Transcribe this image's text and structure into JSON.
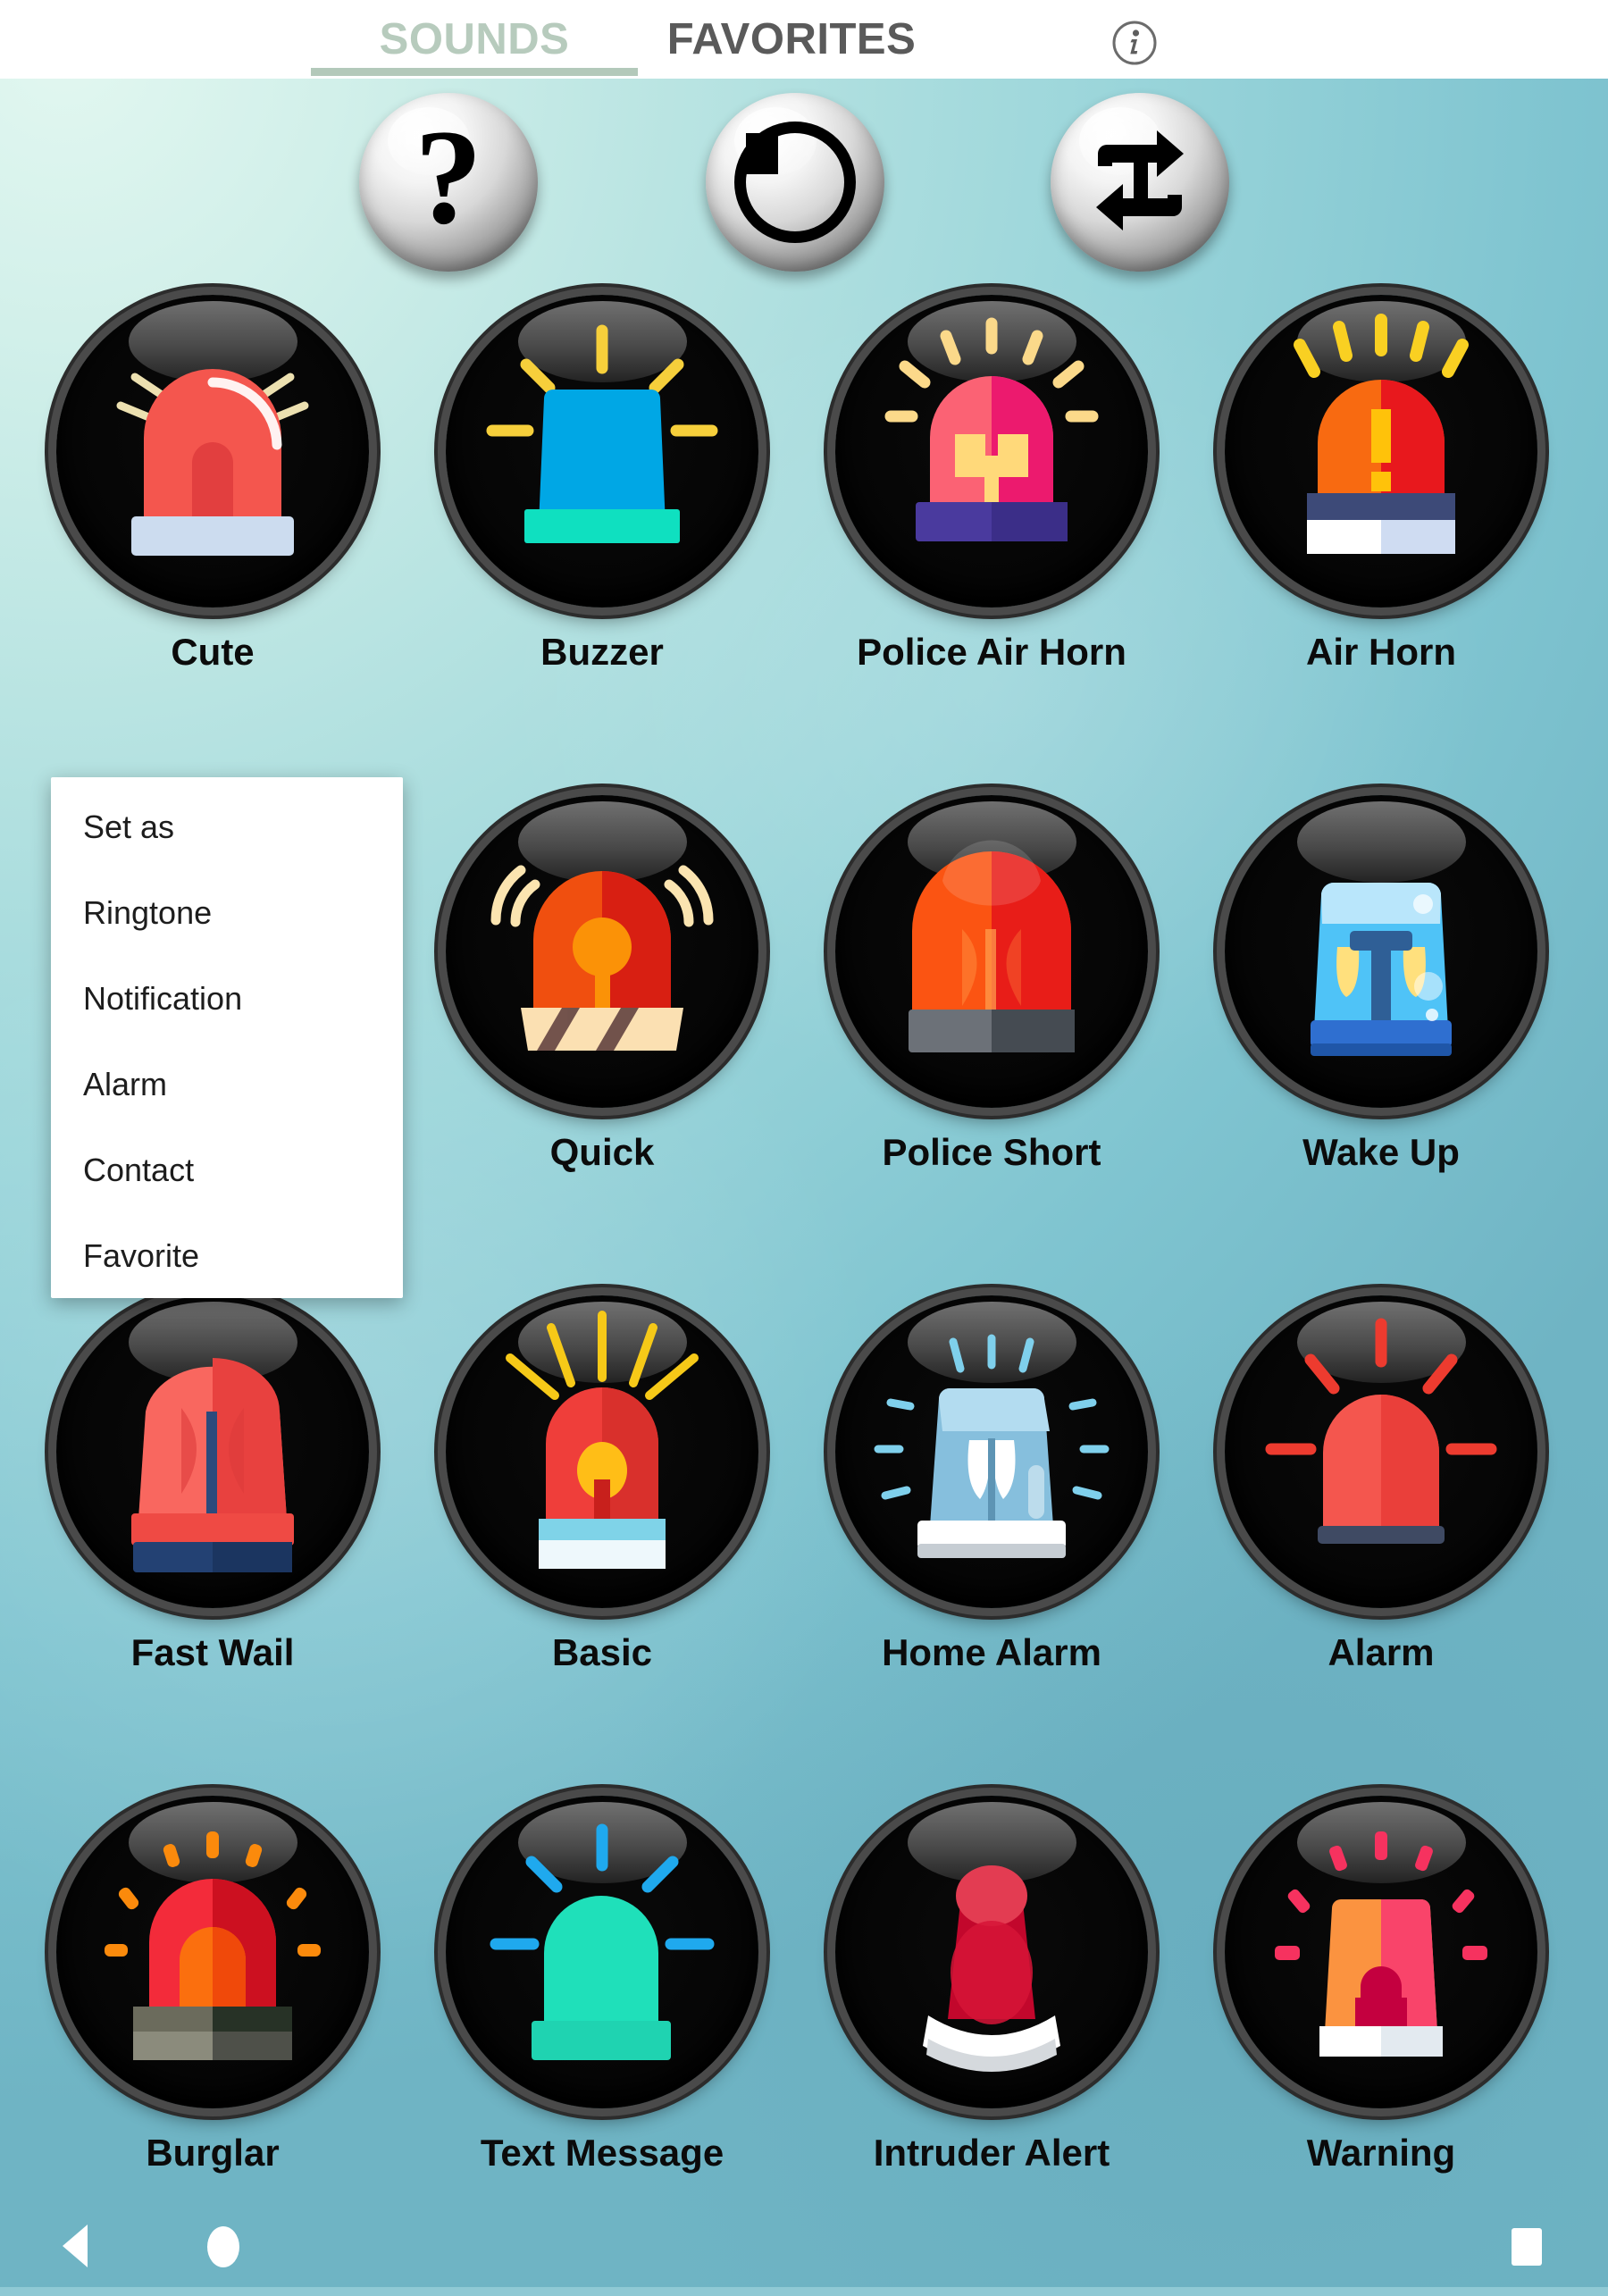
{
  "app": {
    "background_top_color": "#d9f3ec",
    "background_bottom_color": "#6fb4c4"
  },
  "tabs": {
    "items": [
      {
        "label": "SOUNDS",
        "active": true,
        "color": "#b7cbbd"
      },
      {
        "label": "FAVORITES",
        "active": false,
        "color": "#5a5a5a"
      }
    ],
    "info_icon": "info-icon"
  },
  "controls": [
    {
      "name": "help-button",
      "icon": "question-mark-icon",
      "glyph": "?"
    },
    {
      "name": "stop-button",
      "icon": "stop-icon",
      "glyph": ""
    },
    {
      "name": "loop-button",
      "icon": "repeat-icon",
      "glyph": ""
    }
  ],
  "context_menu": {
    "items": [
      {
        "label": "Set as"
      },
      {
        "label": "Ringtone"
      },
      {
        "label": "Notification"
      },
      {
        "label": "Alarm"
      },
      {
        "label": "Contact"
      },
      {
        "label": "Favorite"
      }
    ]
  },
  "sounds": {
    "rows": [
      [
        {
          "label": "Cute",
          "icon": "siren-red-dome-icon"
        },
        {
          "label": "Buzzer",
          "icon": "siren-blue-square-icon"
        },
        {
          "label": "Police Air Horn",
          "icon": "siren-pink-horn-icon"
        },
        {
          "label": "Air Horn",
          "icon": "siren-orange-exclaim-icon"
        }
      ],
      [
        {
          "label": "",
          "icon": ""
        },
        {
          "label": "Quick",
          "icon": "siren-red-pin-icon"
        },
        {
          "label": "Police Short",
          "icon": "siren-orange-red-icon"
        },
        {
          "label": "Wake Up",
          "icon": "siren-blue-bell-icon"
        }
      ],
      [
        {
          "label": "Fast Wail",
          "icon": "siren-red-navy-icon"
        },
        {
          "label": "Basic",
          "icon": "siren-red-rays-icon"
        },
        {
          "label": "Home Alarm",
          "icon": "siren-lightblue-bell-icon"
        },
        {
          "label": "Alarm",
          "icon": "siren-red-flash-icon"
        }
      ],
      [
        {
          "label": "Burglar",
          "icon": "siren-red-orange-icon"
        },
        {
          "label": "Text Message",
          "icon": "siren-teal-icon"
        },
        {
          "label": "Intruder Alert",
          "icon": "siren-crimson-bulb-icon"
        },
        {
          "label": "Warning",
          "icon": "siren-orange-lock-icon"
        }
      ]
    ]
  },
  "navbar": {
    "back": "back-triangle-icon",
    "home": "home-circle-icon",
    "recents": "recents-square-icon"
  }
}
